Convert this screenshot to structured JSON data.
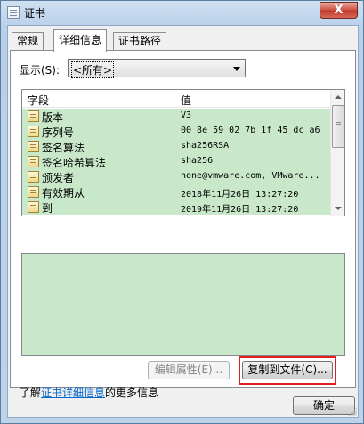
{
  "window": {
    "title": "证书",
    "close_glyph": "X"
  },
  "tabs": [
    {
      "label": "常规",
      "active": false
    },
    {
      "label": "详细信息",
      "active": true
    },
    {
      "label": "证书路径",
      "active": false
    }
  ],
  "show_filter": {
    "label": "显示(S):",
    "selected": "<所有>"
  },
  "field_list": {
    "columns": [
      "字段",
      "值"
    ],
    "rows": [
      {
        "field": "版本",
        "value": "V3"
      },
      {
        "field": "序列号",
        "value": "00 8e 59 02 7b 1f 45 dc a6"
      },
      {
        "field": "签名算法",
        "value": "sha256RSA"
      },
      {
        "field": "签名哈希算法",
        "value": "sha256"
      },
      {
        "field": "颁发者",
        "value": "none@vmware.com, VMware..."
      },
      {
        "field": "有效期从",
        "value": "2018年11月26日 13:27:20"
      },
      {
        "field": "到",
        "value": "2019年11月26日 13:27:20"
      }
    ]
  },
  "buttons": {
    "edit_properties": "编辑属性(E)...",
    "copy_to_file": "复制到文件(C)...",
    "ok": "确定"
  },
  "info": {
    "prefix": "了解",
    "link": "证书详细信息",
    "suffix": "的更多信息"
  },
  "colors": {
    "list_row_bg": "#c9e8c9",
    "highlight_border": "#e0201e",
    "link": "#0066cc"
  }
}
